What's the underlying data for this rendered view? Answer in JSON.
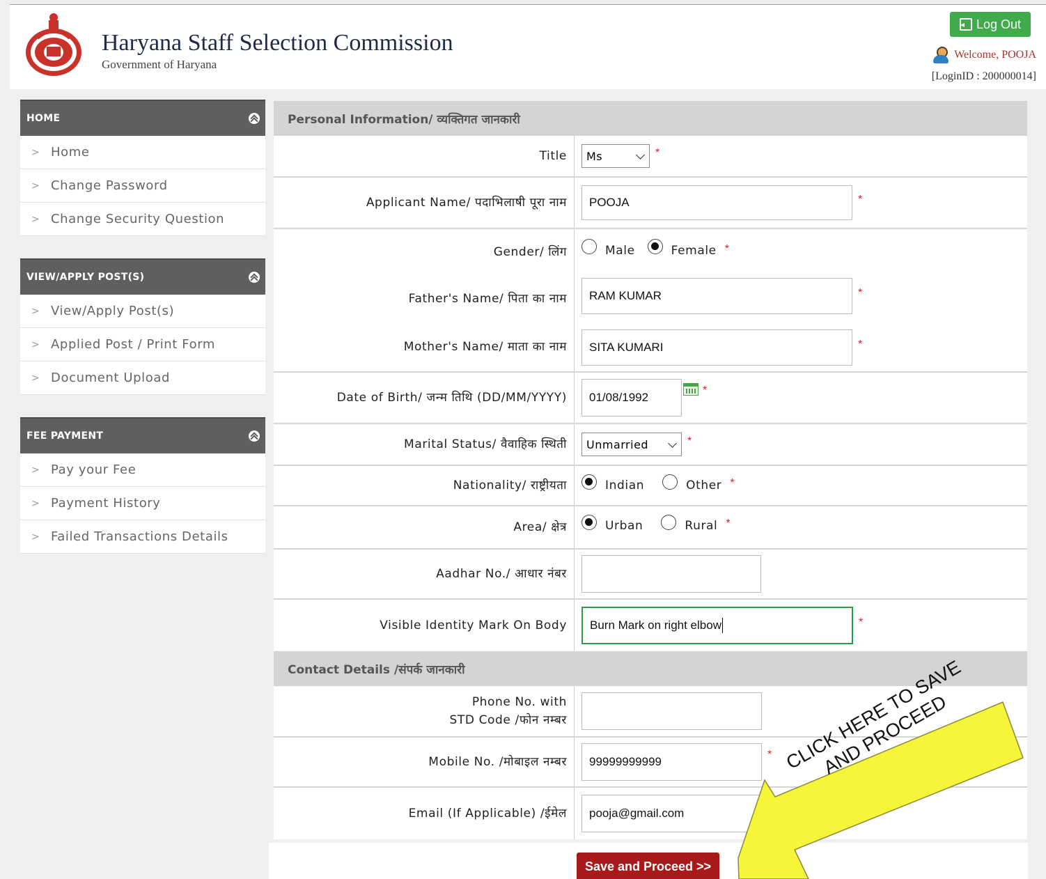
{
  "header": {
    "title": "Haryana Staff Selection Commission",
    "subtitle": "Government of Haryana",
    "logout_label": "Log Out",
    "welcome": "Welcome, POOJA",
    "login_id": "[LoginID : 200000014]"
  },
  "sidebar": {
    "sections": [
      {
        "title": "HOME",
        "items": [
          "Home",
          "Change Password",
          "Change Security Question"
        ]
      },
      {
        "title": "VIEW/APPLY POST(S)",
        "items": [
          "View/Apply Post(s)",
          "Applied Post / Print Form",
          "Document Upload"
        ]
      },
      {
        "title": "FEE PAYMENT",
        "items": [
          "Pay your Fee",
          "Payment History",
          "Failed Transactions Details"
        ]
      }
    ]
  },
  "personal": {
    "section_title": "Personal Information/ व्यक्तिगत जानकारी",
    "title_label": "Title",
    "title_value": "Ms",
    "name_label": "Applicant Name/ पदाभिलाषी पूरा नाम",
    "name_value": "POOJA",
    "gender_label": "Gender/ लिंग",
    "gender_options": [
      "Male",
      "Female"
    ],
    "gender_selected": "Female",
    "father_label": "Father's Name/ पिता का नाम",
    "father_value": "RAM KUMAR",
    "mother_label": "Mother's Name/ माता का नाम",
    "mother_value": "SITA KUMARI",
    "dob_label": "Date of Birth/ जन्म तिथि (DD/MM/YYYY)",
    "dob_value": "01/08/1992",
    "marital_label": "Marital Status/ वैवाहिक स्थिती",
    "marital_value": "Unmarried",
    "nationality_label": "Nationality/ राष्ट्रीयता",
    "nationality_options": [
      "Indian",
      "Other"
    ],
    "nationality_selected": "Indian",
    "area_label": "Area/ क्षेत्र",
    "area_options": [
      "Urban",
      "Rural"
    ],
    "area_selected": "Urban",
    "aadhar_label": "Aadhar No./ आधार नंबर",
    "aadhar_value": "",
    "mark_label": "Visible Identity Mark On Body",
    "mark_value": "Burn Mark on right elbow"
  },
  "contact": {
    "section_title": "Contact Details /संपर्क जानकारी",
    "phone_label_line1": "Phone No. with",
    "phone_label_line2": "STD Code /फोन नम्बर",
    "phone_value": "",
    "mobile_label": "Mobile No. /मोबाइल नम्बर",
    "mobile_value": "99999999999",
    "email_label": "Email (If Applicable) /ईमेल",
    "email_value": "pooja@gmail.com"
  },
  "actions": {
    "save_label": "Save and Proceed >>"
  },
  "callout": {
    "line1": "CLICK HERE TO SAVE",
    "line2": "AND PROCEED"
  },
  "colors": {
    "save_button": "#a81a1a",
    "logout_button": "#3fab4a",
    "sidebar_header": "#5f5f5f",
    "section_header": "#d4d4d4",
    "callout": "#f5f53a"
  }
}
